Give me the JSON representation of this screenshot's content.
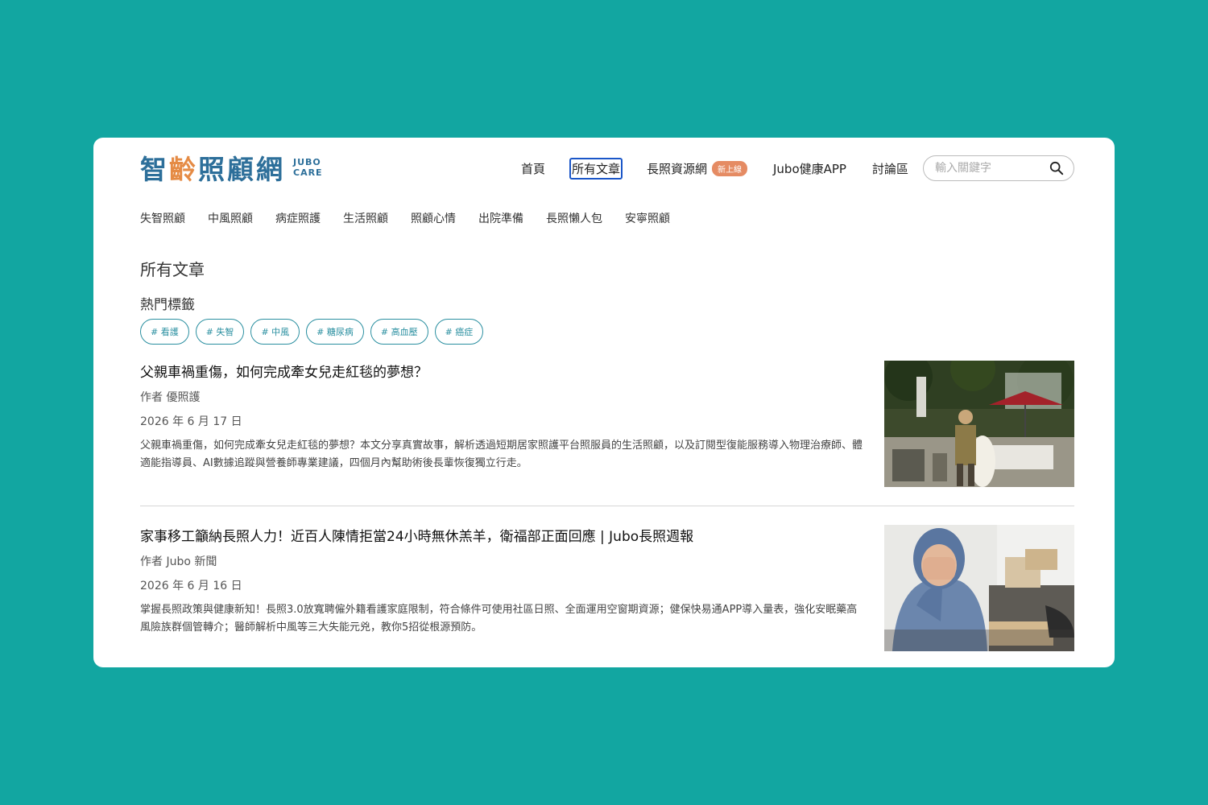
{
  "logo": {
    "zh_chars": [
      "智",
      "齡",
      "照",
      "顧",
      "網"
    ],
    "en_line1": "JUBO",
    "en_line2": "CARE"
  },
  "nav": {
    "items": [
      {
        "label": "首頁"
      },
      {
        "label": "所有文章",
        "active": true
      },
      {
        "label": "長照資源網",
        "badge": "新上線"
      },
      {
        "label": "Jubo健康APP"
      },
      {
        "label": "討論區"
      }
    ],
    "search_placeholder": "輸入關鍵字"
  },
  "categories": [
    "失智照顧",
    "中風照顧",
    "病症照護",
    "生活照顧",
    "照顧心情",
    "出院準備",
    "長照懶人包",
    "安寧照顧"
  ],
  "page_title": "所有文章",
  "tags_title": "熱門標籤",
  "tags": [
    "# 看護",
    "# 失智",
    "# 中風",
    "# 糖尿病",
    "# 高血壓",
    "# 癌症"
  ],
  "articles": [
    {
      "title": "父親車禍重傷，如何完成牽女兒走紅毯的夢想？",
      "author": "作者 優照護",
      "date": "2026 年 6 月 17 日",
      "excerpt": "父親車禍重傷，如何完成牽女兒走紅毯的夢想？本文分享真實故事，解析透過短期居家照護平台照服員的生活照顧，以及訂閱型復能服務導入物理治療師、體適能指導員、AI數據追蹤與營養師專業建議，四個月內幫助術後長輩恢復獨立行走。"
    },
    {
      "title": "家事移工籲納長照人力！近百人陳情拒當24小時無休羔羊，衛福部正面回應 | Jubo長照週報",
      "author": "作者 Jubo 新聞",
      "date": "2026 年 6 月 16 日",
      "excerpt": "掌握長照政策與健康新知！長照3.0放寬聘僱外籍看護家庭限制，符合條件可使用社區日照、全面運用空窗期資源；健保快易通APP導入量表，強化安眠藥高風險族群個管轉介；醫師解析中風等三大失能元兇，教你5招從根源預防。"
    }
  ],
  "colors": {
    "background": "#12a6a1",
    "card": "#ffffff",
    "logo_blue": "#2d6f9a",
    "logo_orange": "#e58b45",
    "tag": "#2a8fa0",
    "badge": "#e58b63",
    "active_outline": "#1a56c8"
  },
  "icons": {
    "search": "search-icon"
  }
}
